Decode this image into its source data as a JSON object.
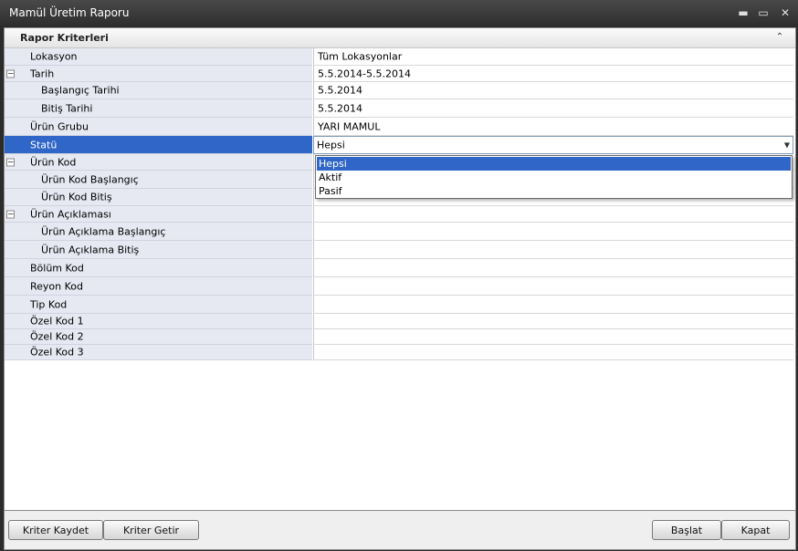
{
  "window": {
    "title": "Mamül Üretim Raporu",
    "minimize_glyph": "▬",
    "maximize_glyph": "▭",
    "close_glyph": "✕"
  },
  "group": {
    "title": "Rapor Kriterleri",
    "collapse_glyph": "⌃"
  },
  "rows": {
    "lokasyon": {
      "label": "Lokasyon",
      "value": "Tüm Lokasyonlar"
    },
    "tarih": {
      "label": "Tarih",
      "value": "5.5.2014-5.5.2014",
      "expander": "−"
    },
    "baslangic_tarihi": {
      "label": "Başlangıç Tarihi",
      "value": "5.5.2014"
    },
    "bitis_tarihi": {
      "label": "Bitiş Tarihi",
      "value": "5.5.2014"
    },
    "urun_grubu": {
      "label": "Ürün Grubu",
      "value": "YARI MAMUL"
    },
    "statu": {
      "label": "Statü",
      "value": "Hepsi",
      "arrow": "▼"
    },
    "urun_kod": {
      "label": "Ürün Kod",
      "value": "",
      "expander": "−"
    },
    "urun_kod_baslangic": {
      "label": "Ürün Kod Başlangıç",
      "value": ""
    },
    "urun_kod_bitis": {
      "label": "Ürün Kod Bitiş",
      "value": ""
    },
    "urun_aciklamasi": {
      "label": "Ürün Açıklaması",
      "value": "",
      "expander": "−"
    },
    "urun_aciklama_baslangic": {
      "label": "Ürün Açıklama Başlangıç",
      "value": ""
    },
    "urun_aciklama_bitis": {
      "label": "Ürün Açıklama Bitiş",
      "value": ""
    },
    "bolum_kod": {
      "label": "Bölüm Kod",
      "value": ""
    },
    "reyon_kod": {
      "label": "Reyon Kod",
      "value": ""
    },
    "tip_kod": {
      "label": "Tip Kod",
      "value": ""
    },
    "ozel_kod_1": {
      "label": "Özel Kod 1",
      "value": ""
    },
    "ozel_kod_2": {
      "label": "Özel Kod 2",
      "value": ""
    },
    "ozel_kod_3": {
      "label": "Özel Kod 3",
      "value": ""
    }
  },
  "dropdown": {
    "options": [
      "Hepsi",
      "Aktif",
      "Pasif"
    ]
  },
  "footer": {
    "kriter_kaydet": "Kriter Kaydet",
    "kriter_getir": "Kriter Getir",
    "baslat": "Başlat",
    "kapat": "Kapat"
  }
}
